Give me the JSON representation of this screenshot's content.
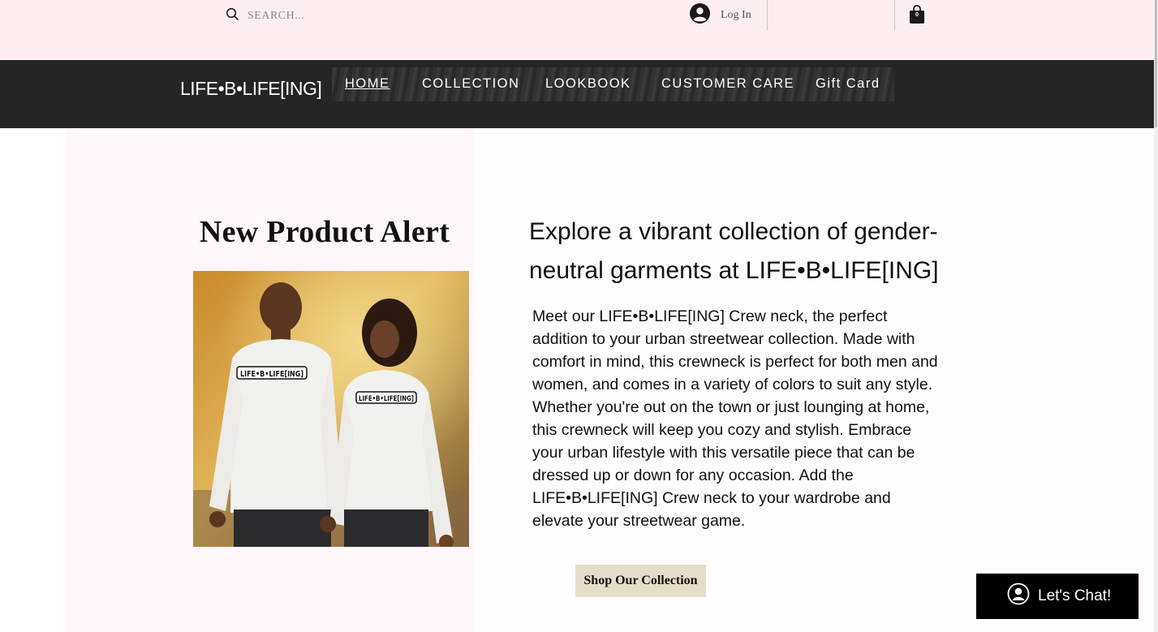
{
  "header": {
    "search_placeholder": "SEARCH...",
    "login_label": "Log In",
    "cart_count": "0"
  },
  "nav": {
    "logo": "LIFE•B•LIFE[ING]",
    "items": [
      {
        "label": "HOME",
        "active": true
      },
      {
        "label": "COLLECTION"
      },
      {
        "label": "LOOKBOOK"
      },
      {
        "label": "CUSTOMER CARE"
      },
      {
        "label": "Gift Card"
      }
    ]
  },
  "main": {
    "product_title": "New Product Alert",
    "headline": "Explore a vibrant collection of gender-neutral garments at LIFE•B•LIFE[ING]",
    "description": "Meet our LIFE•B•LIFE[ING] Crew neck, the perfect addition to your urban streetwear collection. Made with comfort in mind, this crewneck is perfect for both men and women, and comes in a variety of colors to suit any style. Whether you're out on the town or just lounging at home, this crewneck will keep you cozy and stylish. Embrace your urban lifestyle with this versatile piece that can be dressed up or down for any occasion. Add the LIFE•B•LIFE[ING] Crew neck to your wardrobe and elevate your streetwear game.",
    "shop_button": "Shop Our Collection",
    "shirt_print": "LIFE•B•LIFE[ING]"
  },
  "chat": {
    "label": "Let's Chat!"
  },
  "colors": {
    "topbar": "#fdeef2",
    "navbar": "#252525",
    "button": "#e6ddc8"
  }
}
